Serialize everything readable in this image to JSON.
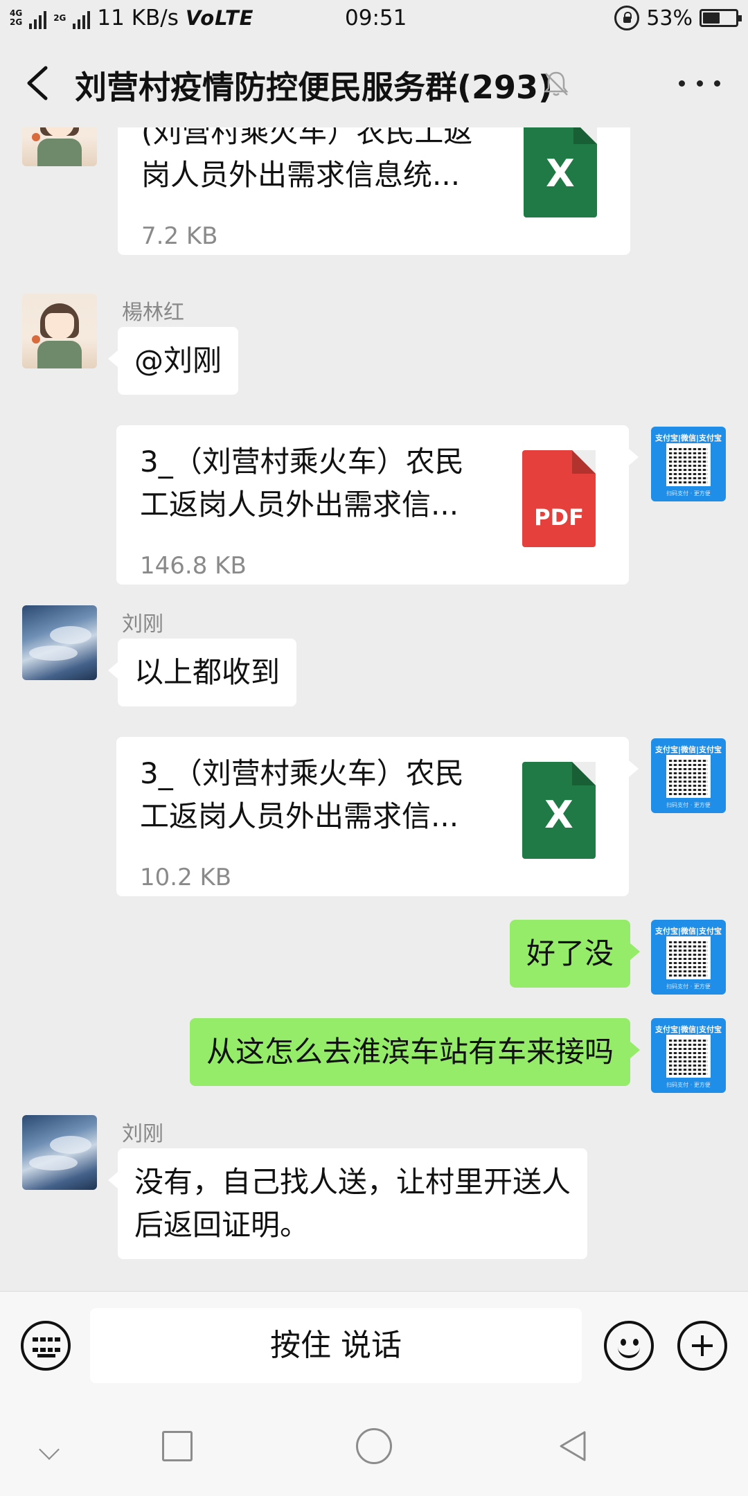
{
  "status_bar": {
    "network_top": "4G",
    "network_bottom": "2G",
    "network2": "2G",
    "speed": "11 KB/s",
    "volte": "VoLTE",
    "time": "09:51",
    "battery_percent": "53%",
    "battery_level": 0.53
  },
  "header": {
    "title": "刘营村疫情防控便民服务群(293)",
    "muted": true
  },
  "messages": [
    {
      "kind": "file",
      "sender": "",
      "file_name": "(刘营村乘火车）农民工返岗人员外出需求信息统...",
      "file_size": "7.2 KB",
      "file_type": "X"
    },
    {
      "kind": "text",
      "sender": "楊林红",
      "text": "@刘刚"
    },
    {
      "kind": "file",
      "sender": "self",
      "file_name": "3_（刘营村乘火车）农民工返岗人员外出需求信...",
      "file_size": "146.8 KB",
      "file_type": "PDF"
    },
    {
      "kind": "text",
      "sender": "刘刚",
      "text": "以上都收到"
    },
    {
      "kind": "file",
      "sender": "self",
      "file_name": "3_（刘营村乘火车）农民工返岗人员外出需求信...",
      "file_size": "10.2 KB",
      "file_type": "X"
    },
    {
      "kind": "text",
      "sender": "self",
      "text": "好了没"
    },
    {
      "kind": "text",
      "sender": "self",
      "text": "从这怎么去淮滨车站有车来接吗"
    },
    {
      "kind": "text",
      "sender": "刘刚",
      "text": "没有，自己找人送，让村里开送人后返回证明。"
    }
  ],
  "file_lines": [
    [
      "(刘营村乘火车）农民工返",
      "岗人员外出需求信息统..."
    ],
    [
      "3_（刘营村乘火车）农民",
      "工返岗人员外出需求信..."
    ],
    [
      "3_（刘营村乘火车）农民",
      "工返岗人员外出需求信..."
    ]
  ],
  "text_lines": {
    "last_reply": [
      "没有，自己找人送，让村里开送人",
      "后返回证明。"
    ]
  },
  "self_avatar_text": {
    "top": "支付宝|微信|支付宝",
    "bottom": "扫码支付 · 更方便"
  },
  "input_bar": {
    "voice_label": "按住 说话"
  },
  "colors": {
    "background": "#ededed",
    "self_bubble": "#95ec69",
    "other_bubble": "#ffffff",
    "excel_icon": "#1f7a45",
    "pdf_icon": "#e5403c"
  },
  "icons": [
    "back-arrow-icon",
    "bell-muted-icon",
    "more-icon",
    "keyboard-icon",
    "emoji-icon",
    "plus-icon",
    "nav-down-icon",
    "nav-recent-icon",
    "nav-home-icon",
    "nav-back-icon"
  ]
}
